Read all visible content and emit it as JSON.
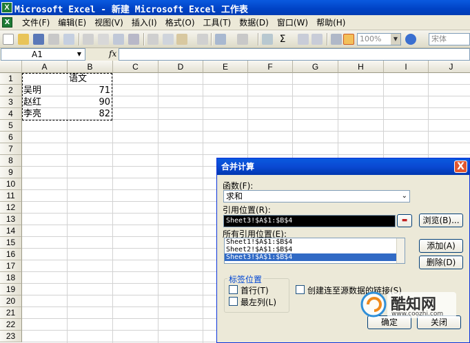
{
  "window": {
    "title": "Microsoft Excel - 新建 Microsoft Excel 工作表",
    "app_icon": "X"
  },
  "menu": {
    "doc_icon": "X",
    "items": [
      "文件(F)",
      "编辑(E)",
      "视图(V)",
      "插入(I)",
      "格式(O)",
      "工具(T)",
      "数据(D)",
      "窗口(W)",
      "帮助(H)"
    ]
  },
  "toolbar": {
    "zoom": "100%",
    "font": "宋体"
  },
  "formula_bar": {
    "name_box": "A1",
    "fx_label": "fx",
    "formula": ""
  },
  "grid": {
    "columns": [
      "A",
      "B",
      "C",
      "D",
      "E",
      "F",
      "G",
      "H",
      "I",
      "J"
    ],
    "rows": [
      "1",
      "2",
      "3",
      "4",
      "5",
      "6",
      "7",
      "8",
      "9",
      "10",
      "11",
      "12",
      "13",
      "14",
      "15",
      "16",
      "17",
      "18",
      "19",
      "20",
      "21",
      "22",
      "23"
    ],
    "cells": {
      "B1": "语文",
      "A2": "吴明",
      "B2": "71",
      "A3": "赵红",
      "B3": "90",
      "A4": "李亮",
      "B4": "82"
    }
  },
  "dialog": {
    "title": "合并计算",
    "close": "X",
    "function_label": "函数(F):",
    "function_value": "求和",
    "reference_label": "引用位置(R):",
    "reference_value": "Sheet3!$A$1:$B$4",
    "browse_button": "浏览(B)...",
    "all_references_label": "所有引用位置(E):",
    "all_references": [
      "Sheet1!$A$1:$B$4",
      "Sheet2!$A$1:$B$4",
      "Sheet3!$A$1:$B$4"
    ],
    "selected_reference_index": 2,
    "add_button": "添加(A)",
    "delete_button": "删除(D)",
    "label_group": "标签位置",
    "top_row_label": "首行(T)",
    "left_column_label": "最左列(L)",
    "link_label": "创建连至源数据的链接(S)",
    "ok_button": "确定",
    "close_button": "关闭"
  },
  "watermark": {
    "brand": "酷知网",
    "url": "www.coozhi.com"
  }
}
